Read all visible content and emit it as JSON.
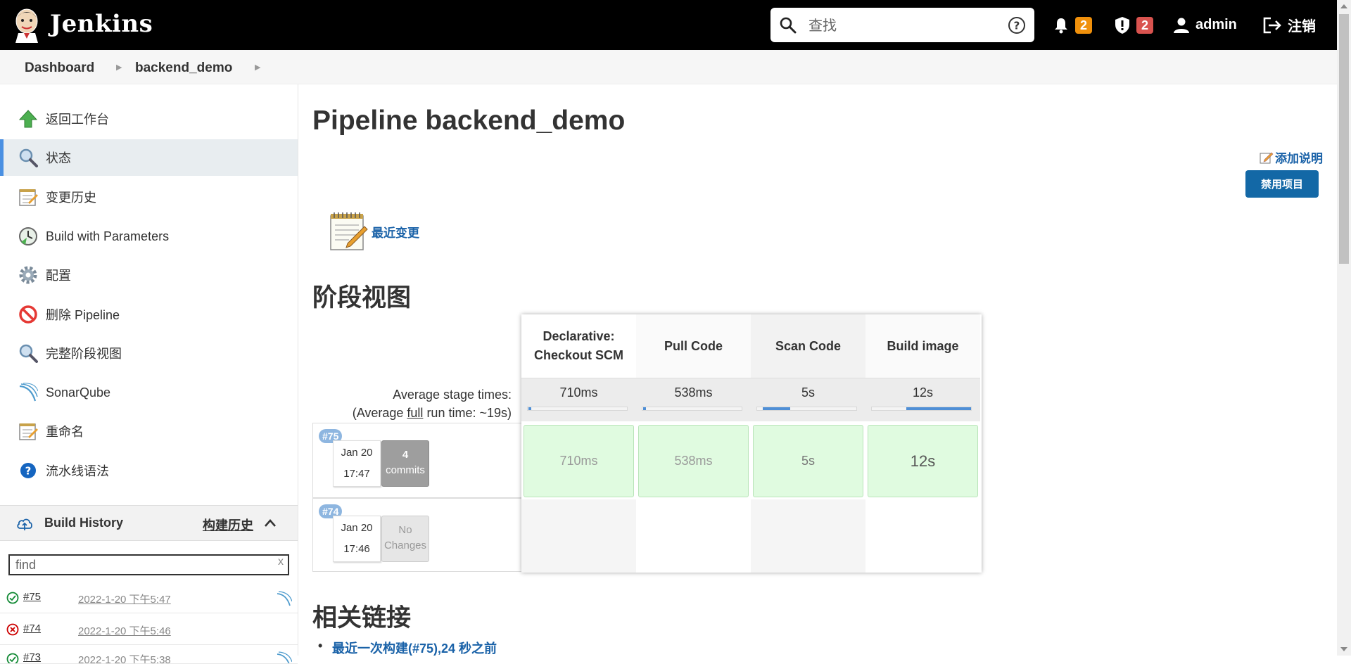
{
  "header": {
    "brand": "Jenkins",
    "search_placeholder": "查找",
    "notifications_count": "2",
    "security_count": "2",
    "user": "admin",
    "logout": "注销"
  },
  "breadcrumb": [
    "Dashboard",
    "backend_demo"
  ],
  "sidebar": {
    "items": [
      {
        "label": "返回工作台",
        "icon": "up-arrow-icon"
      },
      {
        "label": "状态",
        "icon": "search-icon"
      },
      {
        "label": "变更历史",
        "icon": "notepad-icon"
      },
      {
        "label": "Build with Parameters",
        "icon": "clock-icon"
      },
      {
        "label": "配置",
        "icon": "gear-icon"
      },
      {
        "label": "删除 Pipeline",
        "icon": "no-entry-icon"
      },
      {
        "label": "完整阶段视图",
        "icon": "search-icon"
      },
      {
        "label": "SonarQube",
        "icon": "sonarqube-icon"
      },
      {
        "label": "重命名",
        "icon": "notepad-icon"
      },
      {
        "label": "流水线语法",
        "icon": "help-icon"
      }
    ]
  },
  "build_history": {
    "title": "Build History",
    "link": "构建历史",
    "filter_placeholder": "find",
    "clear": "x",
    "builds": [
      {
        "number": "#75",
        "time": "2022-1-20 下午5:47",
        "status": "success"
      },
      {
        "number": "#74",
        "time": "2022-1-20 下午5:46",
        "status": "failed"
      },
      {
        "number": "#73",
        "time": "2022-1-20 下午5:38",
        "status": "success"
      }
    ]
  },
  "main": {
    "title": "Pipeline backend_demo",
    "add_description": "添加说明",
    "disable_button": "禁用项目",
    "recent_changes": "最近变更",
    "stage_view_heading": "阶段视图",
    "related_links_heading": "相关链接",
    "related_link": "最近一次构建(#75),24 秒之前"
  },
  "stage_view": {
    "avg_label_line1": "Average stage times:",
    "avg_label_prefix": "(Average ",
    "avg_label_full": "full",
    "avg_label_suffix": " run time: ~19s)",
    "stages": [
      {
        "name_line1": "Declarative:",
        "name_line2": "Checkout SCM",
        "avg": "710ms",
        "avg_fraction": 0.03
      },
      {
        "name_line1": "Pull Code",
        "name_line2": "",
        "avg": "538ms",
        "avg_fraction": 0.03
      },
      {
        "name_line1": "Scan Code",
        "name_line2": "",
        "avg": "5s",
        "avg_fraction": 0.28
      },
      {
        "name_line1": "Build image",
        "name_line2": "",
        "avg": "12s",
        "avg_fraction": 0.65
      }
    ],
    "runs": [
      {
        "badge": "#75",
        "date": "Jan 20",
        "time": "17:47",
        "commits_count": "4",
        "commits_label": "commits",
        "durations": [
          "710ms",
          "538ms",
          "5s",
          "12s"
        ]
      },
      {
        "badge": "#74",
        "date": "Jan 20",
        "time": "17:46",
        "commits_count": "No",
        "commits_label": "Changes",
        "durations": []
      }
    ]
  },
  "colors": {
    "header_bg": "#000000",
    "accent": "#1a62a8",
    "notification_badge": "#f0900b",
    "security_badge": "#d9534f",
    "stage_success": "#e0fbe0"
  }
}
